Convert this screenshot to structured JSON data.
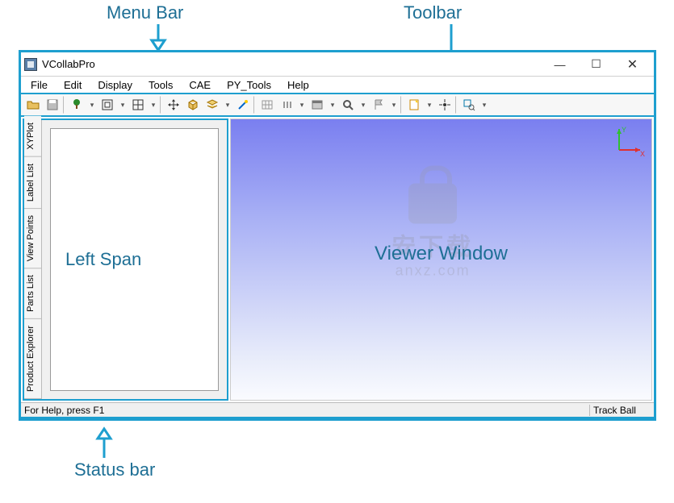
{
  "annotations": {
    "menubar": "Menu Bar",
    "toolbar": "Toolbar",
    "statusbar": "Status bar",
    "leftspan": "Left Span",
    "viewer": "Viewer Window"
  },
  "window": {
    "title": "VCollabPro",
    "controls": {
      "min": "—",
      "max": "☐",
      "close": "✕"
    }
  },
  "menu": {
    "items": [
      "File",
      "Edit",
      "Display",
      "Tools",
      "CAE",
      "PY_Tools",
      "Help"
    ]
  },
  "toolbar": {
    "buttons": [
      {
        "name": "open-icon"
      },
      {
        "name": "save-icon"
      },
      {
        "sep": true
      },
      {
        "name": "tree-icon"
      },
      {
        "drop": true
      },
      {
        "name": "fit-icon"
      },
      {
        "drop": true
      },
      {
        "name": "grid-icon"
      },
      {
        "drop": true
      },
      {
        "sep": true
      },
      {
        "name": "move-icon"
      },
      {
        "name": "box3d-icon"
      },
      {
        "name": "layers-icon"
      },
      {
        "drop": true
      },
      {
        "name": "wand-icon"
      },
      {
        "sep": true
      },
      {
        "name": "mesh-icon"
      },
      {
        "name": "list-icon"
      },
      {
        "drop": true
      },
      {
        "name": "window-icon"
      },
      {
        "drop": true
      },
      {
        "name": "zoom-icon"
      },
      {
        "drop": true
      },
      {
        "name": "flag-icon"
      },
      {
        "drop": true
      },
      {
        "sep": true
      },
      {
        "name": "note-icon"
      },
      {
        "drop": true
      },
      {
        "name": "target-icon"
      },
      {
        "sep": true
      },
      {
        "name": "select-zoom-icon"
      },
      {
        "drop": true
      }
    ]
  },
  "left_tabs": [
    "Product Explorer",
    "Parts List",
    "View Points",
    "Label List",
    "XYPlot"
  ],
  "watermark": {
    "line1": "安下载",
    "line2": "anxz.com"
  },
  "status": {
    "left": "For Help, press F1",
    "right": "Track Ball"
  },
  "axis": {
    "x": "X",
    "y": "Y"
  }
}
